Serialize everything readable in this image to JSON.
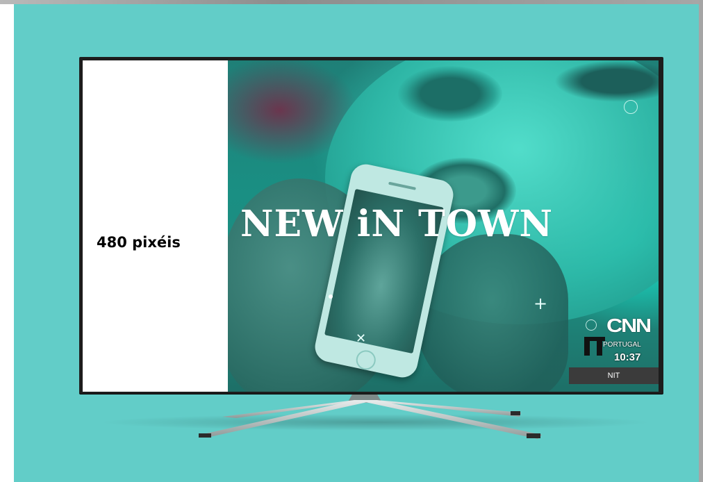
{
  "ad_space_label": "480 pixéis",
  "broadcast": {
    "headline": "NEW iN TOWN",
    "network": "CNN",
    "country": "PORTUGAL",
    "time": "10:37",
    "program_tag": "NIT"
  },
  "colors": {
    "backdrop": "#62cdc8",
    "screen_tint": "#14a595",
    "tag_background": "#3b3b3b"
  },
  "icons": [
    "plus-icon",
    "circle-icon",
    "close-icon",
    "nit-logo-icon"
  ]
}
